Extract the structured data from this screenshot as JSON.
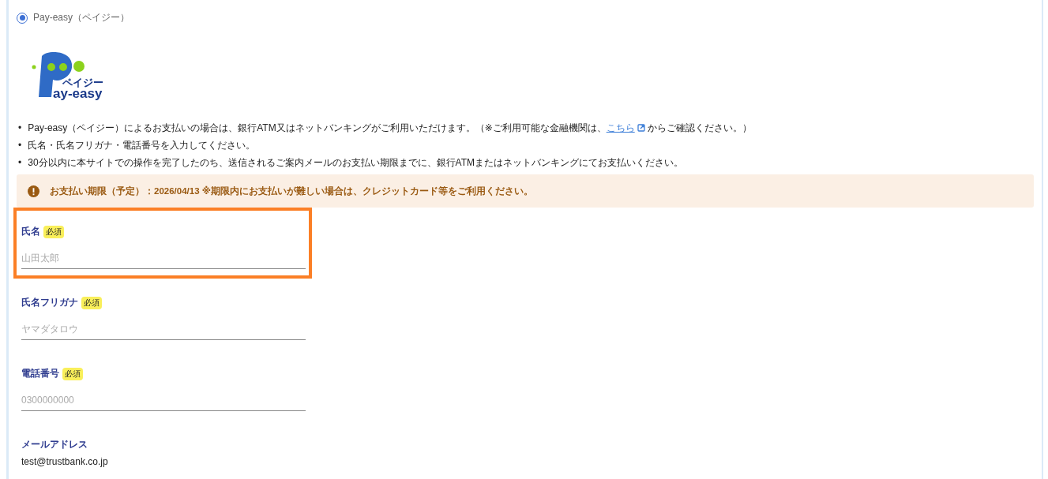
{
  "payment_option": {
    "label": "Pay-easy（ペイジー）",
    "selected": true
  },
  "logo": {
    "kana": "ペイジー",
    "wordmark": "ay-easy"
  },
  "notes": [
    {
      "marker": "•",
      "before": "Pay-easy（ペイジー）によるお支払いの場合は、銀行ATM又はネットバンキングがご利用いただけます。（※ご利用可能な金融機関は、",
      "link": "こちら",
      "after": "からご確認ください。）"
    },
    {
      "marker": "•",
      "before": "氏名・氏名フリガナ・電話番号を入力してください。"
    },
    {
      "marker": "•",
      "before": "30分以内に本サイトでの操作を完了したのち、送信されるご案内メールのお支払い期限までに、銀行ATMまたはネットバンキングにてお支払いください。"
    }
  ],
  "alert": {
    "text": "お支払い期限（予定）：2026/04/13 ※期限内にお支払いが難しい場合は、クレジットカード等をご利用ください。"
  },
  "fields": [
    {
      "kind": "input",
      "label": "氏名",
      "required": "必須",
      "placeholder": "山田太郎",
      "highlighted": true
    },
    {
      "kind": "input",
      "label": "氏名フリガナ",
      "required": "必須",
      "placeholder": "ヤマダタロウ",
      "highlighted": false
    },
    {
      "kind": "input",
      "label": "電話番号",
      "required": "必須",
      "placeholder": "0300000000",
      "highlighted": false
    },
    {
      "kind": "static",
      "label": "メールアドレス",
      "value": "test@trustbank.co.jp",
      "highlighted": false
    }
  ]
}
